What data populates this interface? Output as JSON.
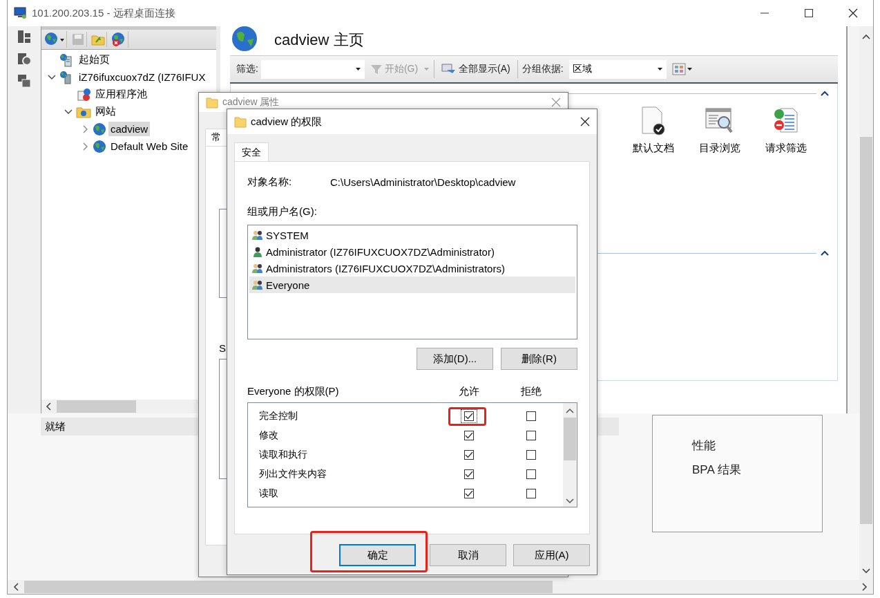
{
  "window": {
    "title": "101.200.203.15 - 远程桌面连接"
  },
  "iis": {
    "tree": [
      {
        "kind": "start",
        "label": "起始页",
        "selected": false
      },
      {
        "kind": "server",
        "label": "iZ76ifuxcuox7dZ (IZ76IFUX",
        "selected": false,
        "expanded": true,
        "children": [
          {
            "kind": "pools",
            "label": "应用程序池",
            "selected": false
          },
          {
            "kind": "sites",
            "label": "网站",
            "selected": false,
            "expanded": true,
            "children": [
              {
                "kind": "site",
                "label": "cadview",
                "selected": true,
                "expanded": false
              },
              {
                "kind": "site",
                "label": "Default Web Site",
                "selected": false,
                "expanded": false
              }
            ]
          }
        ]
      }
    ],
    "status": "就绪",
    "page_title": "cadview 主页",
    "filter_label": "筛选:",
    "start_button": "开始(G)",
    "show_all_button": "全部显示(A)",
    "group_by_label": "分组依据:",
    "group_by_value": "区域",
    "groups": [
      {
        "expanded": true,
        "features": [
          {
            "kind": "default-document",
            "label": "默认文档"
          },
          {
            "kind": "directory-browsing",
            "label": "目录浏览"
          },
          {
            "kind": "request-filtering",
            "label": "请求筛选"
          }
        ]
      },
      {
        "expanded": true
      }
    ],
    "lower_items": [
      "性能",
      "BPA 结果"
    ]
  },
  "properties_dialog": {
    "title": "cadview 属性",
    "active": false,
    "tab": "常",
    "fragments": [
      {
        "kind": "list"
      },
      {
        "kind": "text",
        "text": "S"
      },
      {
        "kind": "list"
      }
    ]
  },
  "permissions_dialog": {
    "title": "cadview 的权限",
    "active": true,
    "tabs": [
      {
        "label": "安全",
        "selected": true
      }
    ],
    "object_label": "对象名称:",
    "object_path": "C:\\Users\\Administrator\\Desktop\\cadview",
    "principals_label": "组或用户名(G):",
    "principals": [
      {
        "kind": "group",
        "name": "SYSTEM",
        "selected": false
      },
      {
        "kind": "user",
        "name": "Administrator (IZ76IFUXCUOX7DZ\\Administrator)",
        "selected": false
      },
      {
        "kind": "group",
        "name": "Administrators (IZ76IFUXCUOX7DZ\\Administrators)",
        "selected": false
      },
      {
        "kind": "group",
        "name": "Everyone",
        "selected": true
      }
    ],
    "add_button": "添加(D)...",
    "remove_button": "删除(R)",
    "permissions_label": "Everyone 的权限(P)",
    "allow_header": "允许",
    "deny_header": "拒绝",
    "permissions": [
      {
        "name": "完全控制",
        "allow": true,
        "deny": false,
        "focused": true,
        "highlighted": true
      },
      {
        "name": "修改",
        "allow": true,
        "deny": false,
        "focused": false,
        "highlighted": false
      },
      {
        "name": "读取和执行",
        "allow": true,
        "deny": false,
        "focused": false,
        "highlighted": false
      },
      {
        "name": "列出文件夹内容",
        "allow": true,
        "deny": false,
        "focused": false,
        "highlighted": false
      },
      {
        "name": "读取",
        "allow": true,
        "deny": false,
        "focused": false,
        "highlighted": false
      }
    ],
    "buttons": [
      {
        "label": "确定",
        "default": true,
        "highlighted": true
      },
      {
        "label": "取消",
        "default": false,
        "highlighted": false
      },
      {
        "label": "应用(A)",
        "default": false,
        "highlighted": false
      }
    ]
  }
}
